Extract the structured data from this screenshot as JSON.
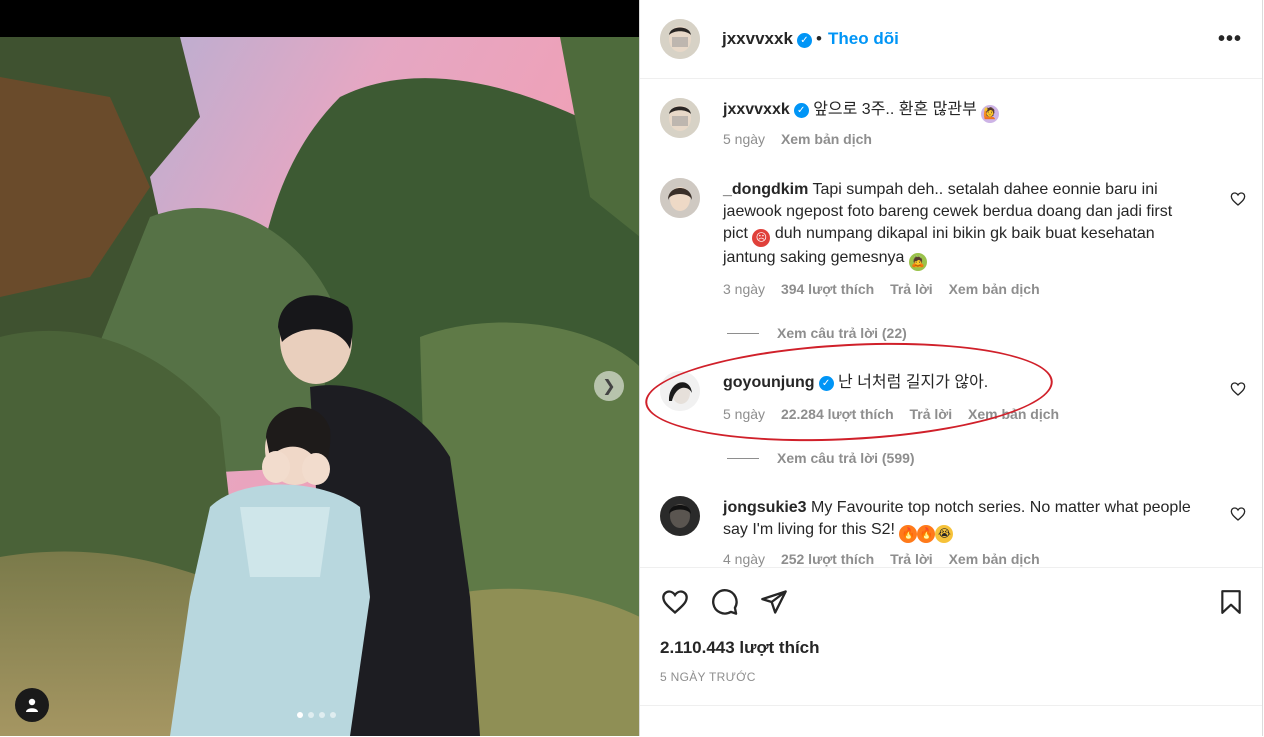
{
  "post": {
    "carousel": {
      "slides": 4,
      "active": 0
    },
    "tagged_people_icon": "user-tag-icon"
  },
  "header": {
    "username": "jxxvvxxk",
    "verified": true,
    "bullet": "•",
    "follow_label": "Theo dõi",
    "more_icon": "more-horizontal-icon"
  },
  "comments": [
    {
      "username": "jxxvvxxk",
      "verified": true,
      "text": "앞으로 3주.. 환혼 많관부",
      "emoji": "person-raising-hand",
      "time": "5 ngày",
      "likes": "",
      "reply": "",
      "translate": "Xem bản dịch"
    },
    {
      "username": "_dongdkim",
      "verified": false,
      "text_1": "Tapi sumpah deh.. setalah dahee eonnie baru ini jaewook ngepost foto bareng cewek berdua doang dan jadi first pict",
      "text_2": "duh numpang dikapal ini bikin gk baik buat kesehatan jantung saking gemesnya",
      "time": "3 ngày",
      "likes": "394 lượt thích",
      "reply": "Trả lời",
      "translate": "Xem bản dịch",
      "view_replies": "Xem câu trả lời (22)"
    },
    {
      "username": "goyounjung",
      "verified": true,
      "text": "난 너처럼 길지가 않아.",
      "time": "5 ngày",
      "likes": "22.284 lượt thích",
      "reply": "Trả lời",
      "translate": "Xem bản dịch",
      "view_replies": "Xem câu trả lời (599)"
    },
    {
      "username": "jongsukie3",
      "verified": false,
      "text": "My Favourite top notch series. No matter what people say I'm living for this S2!",
      "time": "4 ngày",
      "likes": "252 lượt thích",
      "reply": "Trả lời",
      "translate": "Xem bản dịch"
    }
  ],
  "footer": {
    "likes": "2.110.443 lượt thích",
    "posted": "5 NGÀY TRƯỚC",
    "icons": [
      "heart-icon",
      "comment-icon",
      "share-icon",
      "bookmark-icon"
    ]
  },
  "colors": {
    "accent": "#0095f6",
    "highlight": "#d0202a",
    "muted": "#8e8e8e"
  }
}
